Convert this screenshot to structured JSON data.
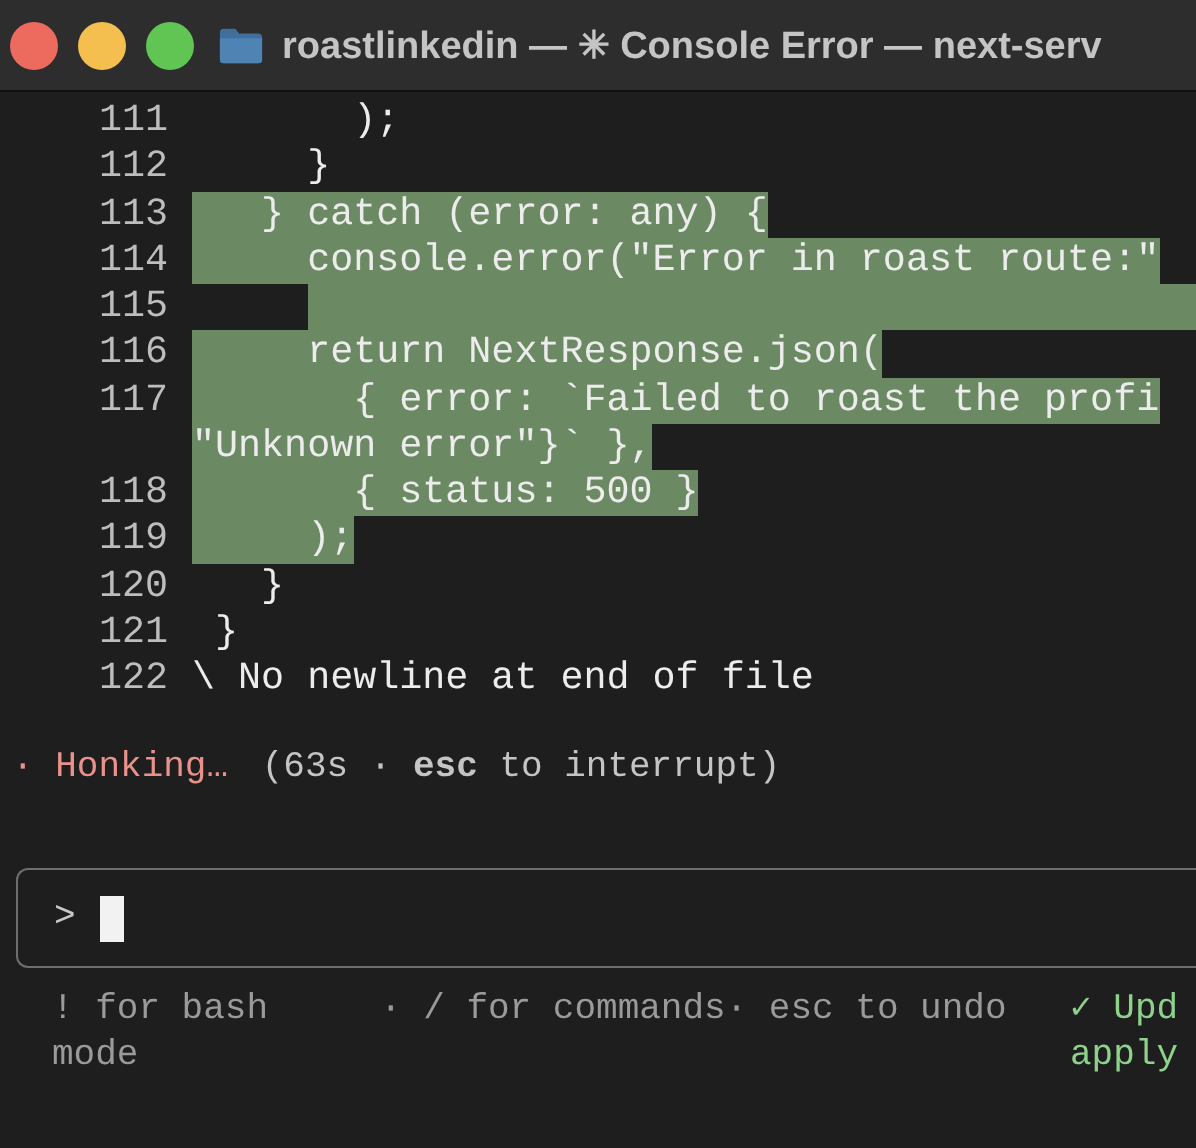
{
  "window": {
    "title": "roastlinkedin — ✳ Console Error — next-serv"
  },
  "code_lines": [
    {
      "number": "111",
      "text": "       );",
      "selected": false
    },
    {
      "number": "112",
      "text": "     }",
      "selected": false
    },
    {
      "number": "113",
      "text": "   } catch (error: any) {",
      "selected": true
    },
    {
      "number": "114",
      "text": "     console.error(\"Error in roast route:\"",
      "selected": true
    },
    {
      "number": "115",
      "selected": true
    },
    {
      "number": "116",
      "text": "     return NextResponse.json(",
      "selected": true
    },
    {
      "number": "117",
      "text": "       { error: `Failed to roast the profi",
      "selected": true
    },
    {
      "text": "\"Unknown error\"}` },",
      "selected": true
    },
    {
      "number": "118",
      "text": "       { status: 500 }",
      "selected": true
    },
    {
      "number": "119",
      "text": "     );",
      "selected": true
    },
    {
      "number": "120",
      "text": "   }",
      "selected": false
    },
    {
      "number": "121",
      "text": " }",
      "selected": false
    },
    {
      "number": "122",
      "text": "\\ No newline at end of file",
      "selected": false
    }
  ],
  "status": {
    "spinner": "·",
    "verb": "Honking…",
    "detail": "(63s · **esc** to interrupt)"
  },
  "prompt": {
    "symbol": ">"
  },
  "hints": [
    "! for bash mode",
    "· / for commands· esc to undo"
  ],
  "update_notice": "✓ Upd apply"
}
